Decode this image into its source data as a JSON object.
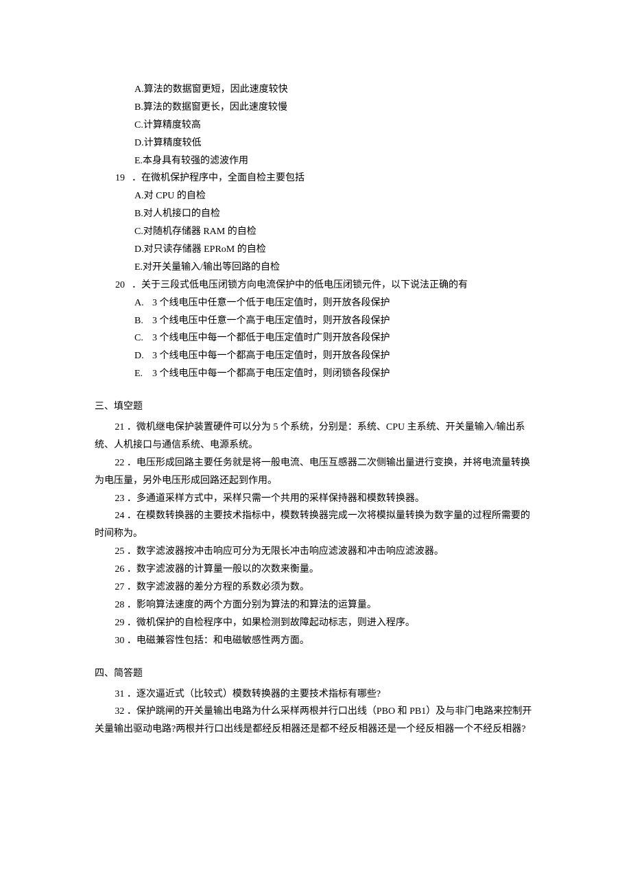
{
  "q18_options": {
    "A": "A.算法的数据窗更短，因此速度较快",
    "B": "B.算法的数据窗更长，因此速度较慢",
    "C": "C.计算精度较高",
    "D": "D.计算精度较低",
    "E": "E.本身具有较强的滤波作用"
  },
  "q19": {
    "num": "19",
    "stem": "．在微机保护程序中，全面自检主要包括",
    "options": {
      "A": "A.对 CPU 的自检",
      "B": "B.对人机接口的自检",
      "C": "C.对随机存储器 RAM 的自检",
      "D": "D.对只读存储器 EPRoM 的自检",
      "E": "E.对开关量输入/输出等回路的自检"
    }
  },
  "q20": {
    "num": "20",
    "stem": "．关于三段式低电压闭锁方向电流保护中的低电压闭锁元件，以下说法正确的有",
    "options": {
      "A": {
        "label": "A.",
        "text": "3 个线电压中任意一个低于电压定值时，则开放各段保护"
      },
      "B": {
        "label": "B.",
        "text": "3 个线电压中任意一个高于电压定值时，则开放各段保护"
      },
      "C": {
        "label": "C.",
        "text": "3 个线电压中每一个都低于电压定值时广则开放各段保护"
      },
      "D": {
        "label": "D.",
        "text": "3 个线电压中每一个都高于电压定值时，则开放各段保护"
      },
      "E": {
        "label": "E.",
        "text": "3 个线电压中每一个都高于电压定值时，则闭锁各段保护"
      }
    }
  },
  "section3": {
    "title": "三、填空题",
    "items": {
      "21": "21 ．微机继电保护装置硬件可以分为 5 个系统，分别是：系统、CPU 主系统、开关量输入/输出系统、人机接口与通信系统、电源系统。",
      "22": "22 ．电压形成回路主要任务就是将一般电流、电压互感器二次侧输出量进行变换，并将电流量转换为电压量，另外电压形成回路还起到作用。",
      "23": "23 ．多通道采样方式中，采样只需一个共用的采样保持器和模数转换器。",
      "24": "24 ．在模数转换器的主要技术指标中，模数转换器完成一次将模拟量转换为数字量的过程所需要的时间称为。",
      "25": "25 ．数字滤波器按冲击响应可分为无限长冲击响应滤波器和冲击响应滤波器。",
      "26": "26 ．数字滤波器的计算量一般以的次数来衡量。",
      "27": "27 ．数字滤波器的差分方程的系数必须为数。",
      "28": "28 ．影响算法速度的两个方面分别为算法的和算法的运算量。",
      "29": "29 ．微机保护的自检程序中，如果检测到故障起动标志，则进入程序。",
      "30": "30 ．电磁兼容性包括：和电磁敏感性两方面。"
    }
  },
  "section4": {
    "title": "四、简答题",
    "items": {
      "31": "31 ．逐次逼近式（比较式）模数转换器的主要技术指标有哪些?",
      "32": "32 ．保护跳闸的开关量输出电路为什么采样两根并行口出线（PBO 和 PB1）及与非门电路来控制开关量输出驱动电路?两根并行口出线是都经反相器还是都不经反相器还是一个经反相器一个不经反相器?"
    }
  }
}
